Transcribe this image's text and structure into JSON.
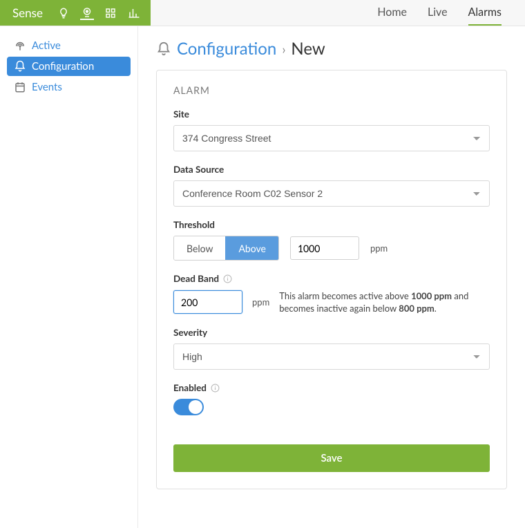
{
  "brand": {
    "name": "Sense"
  },
  "topnav": [
    {
      "label": "Home",
      "active": false
    },
    {
      "label": "Live",
      "active": false
    },
    {
      "label": "Alarms",
      "active": true
    }
  ],
  "sidebar": [
    {
      "label": "Active",
      "active": false,
      "icon": "antenna"
    },
    {
      "label": "Configuration",
      "active": true,
      "icon": "bell"
    },
    {
      "label": "Events",
      "active": false,
      "icon": "calendar"
    }
  ],
  "breadcrumb": {
    "parent": "Configuration",
    "current": "New"
  },
  "panel": {
    "title": "ALARM",
    "site": {
      "label": "Site",
      "value": "374 Congress Street"
    },
    "dataSource": {
      "label": "Data Source",
      "value": "Conference Room C02 Sensor 2"
    },
    "threshold": {
      "label": "Threshold",
      "options": {
        "below": "Below",
        "above": "Above"
      },
      "selected": "above",
      "value": "1000",
      "unit": "ppm"
    },
    "deadBand": {
      "label": "Dead Band",
      "value": "200",
      "unit": "ppm",
      "help_pre": "This alarm becomes active above ",
      "help_val1": "1000 ppm",
      "help_mid": " and becomes inactive again below ",
      "help_val2": "800 ppm",
      "help_post": "."
    },
    "severity": {
      "label": "Severity",
      "value": "High"
    },
    "enabled": {
      "label": "Enabled",
      "value": true
    },
    "save": "Save"
  }
}
